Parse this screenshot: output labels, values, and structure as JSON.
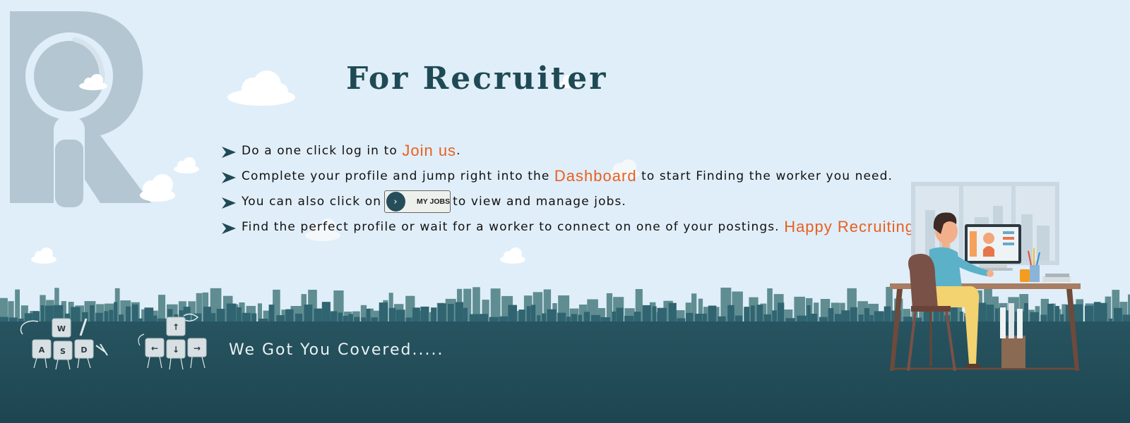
{
  "page": {
    "title": "For Recruiter",
    "tagline": "We Got You Covered....."
  },
  "bullets": [
    {
      "pre": "Do a one click log in to ",
      "highlight": "Join us",
      "post": "."
    },
    {
      "pre": "Complete your profile and jump right into the ",
      "highlight": "Dashboard",
      "post": " to start Finding the worker you need."
    },
    {
      "pre": "You can also click on",
      "button": "MY JOBS",
      "post": "to view and manage jobs."
    },
    {
      "pre": "Find the perfect profile or wait for a worker to connect on one of your postings. ",
      "highlight": "Happy Recruiting."
    }
  ],
  "keycaps_left": [
    "W",
    "A",
    "S",
    "D"
  ],
  "keycaps_right": [
    "↑",
    "←",
    "↓",
    "→"
  ],
  "icons": {
    "bullet": "arrowhead-icon",
    "my_jobs_button": "chevron-right-icon",
    "brand_logo": "r-magnifier-logo"
  },
  "colors": {
    "sky": "#e0eef9",
    "ground": "#244f5a",
    "title": "#1f4a55",
    "highlight": "#e8601f",
    "logo": "#b4c6d2"
  }
}
